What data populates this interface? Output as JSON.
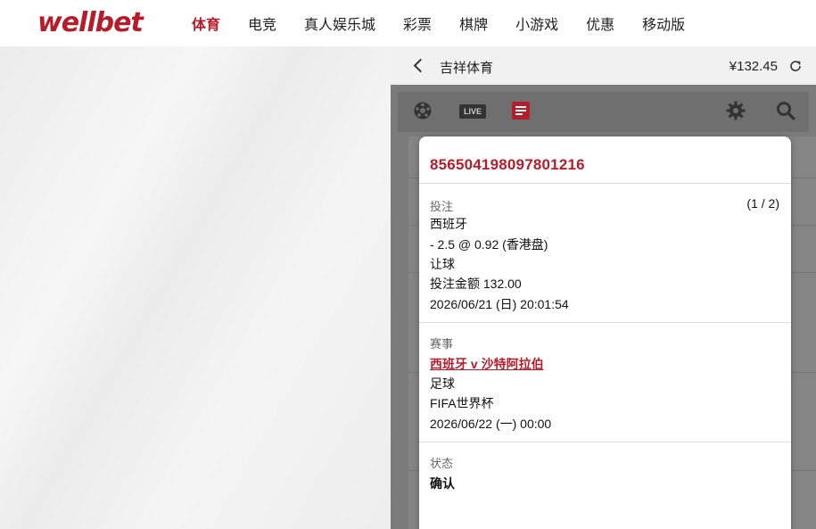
{
  "brand": {
    "logo_text": "wellbet",
    "accent_color": "#b71c2a"
  },
  "nav": {
    "items": [
      {
        "label": "体育",
        "active": true
      },
      {
        "label": "电竞",
        "active": false
      },
      {
        "label": "真人娱乐城",
        "active": false
      },
      {
        "label": "彩票",
        "active": false
      },
      {
        "label": "棋牌",
        "active": false
      },
      {
        "label": "小游戏",
        "active": false
      },
      {
        "label": "优惠",
        "active": false
      },
      {
        "label": "移动版",
        "active": false
      }
    ]
  },
  "panel": {
    "title": "吉祥体育",
    "balance": "¥132.45",
    "toolbar": {
      "icons": [
        "soccer-ball-icon",
        "live-icon",
        "bet-slip-icon",
        "settings-icon",
        "search-icon"
      ],
      "live_label": "LIVE"
    }
  },
  "bet_detail": {
    "bet_id": "856504198097801216",
    "bet": {
      "label": "投注",
      "pager": "(1 / 2)",
      "selection": "西班牙",
      "odds_line": "- 2.5 @ 0.92 (香港盘)",
      "market": "让球",
      "stake": "投注金额 132.00",
      "placed_at": "2026/06/21 (日) 20:01:54"
    },
    "event": {
      "label": "赛事",
      "match": "西班牙 v 沙特阿拉伯",
      "sport": "足球",
      "league": "FIFA世界杯",
      "start_time": "2026/06/22 (一) 00:00"
    },
    "state": {
      "label": "状态",
      "value": "确认"
    }
  }
}
